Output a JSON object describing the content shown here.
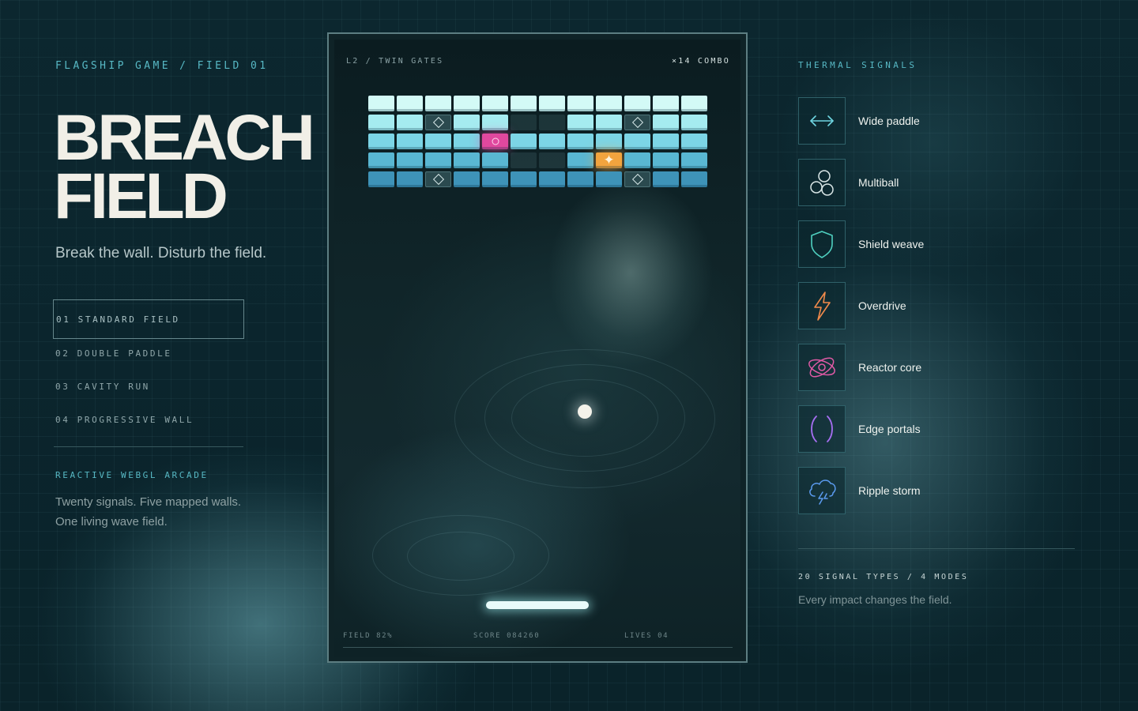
{
  "left": {
    "kicker": "FLAGSHIP GAME / FIELD 01",
    "title_line1": "BREACH",
    "title_line2": "FIELD",
    "subtitle": "Break the wall. Disturb the field.",
    "modes": [
      {
        "label": "01 STANDARD FIELD",
        "active": true
      },
      {
        "label": "02 DOUBLE PADDLE",
        "active": false
      },
      {
        "label": "03 CAVITY RUN",
        "active": false
      },
      {
        "label": "04 PROGRESSIVE WALL",
        "active": false
      }
    ],
    "reactive_label": "REACTIVE WEBGL ARCADE",
    "description_line1": "Twenty signals. Five mapped walls.",
    "description_line2": "One living wave field."
  },
  "game": {
    "level_label": "L2 / TWIN GATES",
    "combo_label": "×14 COMBO",
    "hud": {
      "field": "FIELD 82%",
      "score": "SCORE 084260",
      "lives": "LIVES 04"
    },
    "brick_colors": [
      "#d3faf6",
      "#a5ebf0",
      "#7cd5e6",
      "#59b7d2",
      "#3e93b8"
    ],
    "wall": [
      "NNNNNNNNNNNN",
      "NNDNNEENNDNN",
      "NNNNPNNNNNNN",
      "NNNNNEENONNN",
      "NNDNNNNNNDNN"
    ],
    "pink_icon": "ring-icon",
    "orange_icon": "star-icon",
    "diamond_icon": "diamond-icon",
    "star_glyph": "✦"
  },
  "right": {
    "title": "THERMAL SIGNALS",
    "signals": [
      {
        "label": "Wide paddle",
        "icon": "arrows-horizontal-icon",
        "color": "#6ed4e0"
      },
      {
        "label": "Multiball",
        "icon": "multiball-icon",
        "color": "#d9e6e6"
      },
      {
        "label": "Shield weave",
        "icon": "shield-icon",
        "color": "#4fd0c0"
      },
      {
        "label": "Overdrive",
        "icon": "lightning-icon",
        "color": "#f08a4b"
      },
      {
        "label": "Reactor core",
        "icon": "atom-icon",
        "color": "#e05aa6"
      },
      {
        "label": "Edge portals",
        "icon": "parentheses-icon",
        "color": "#a56ef0"
      },
      {
        "label": "Ripple storm",
        "icon": "storm-cloud-icon",
        "color": "#5b9bf0"
      }
    ],
    "types": "20 SIGNAL TYPES / 4 MODES",
    "footer": "Every impact changes the field."
  }
}
